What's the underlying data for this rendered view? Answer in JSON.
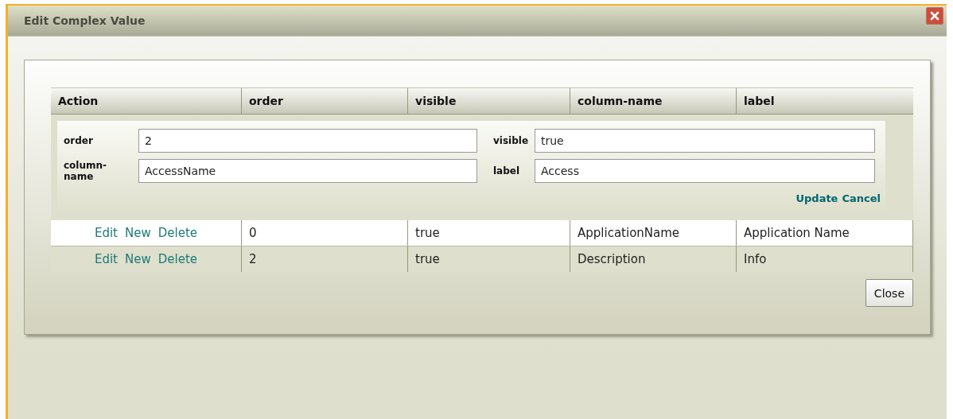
{
  "window": {
    "title": "Edit Complex Value"
  },
  "table": {
    "columns": [
      "Action",
      "order",
      "visible",
      "column-name",
      "label"
    ],
    "edit_form": {
      "fields": [
        {
          "label": "order",
          "value": "2"
        },
        {
          "label": "visible",
          "value": "true"
        },
        {
          "label": "column-name",
          "value": "AccessName"
        },
        {
          "label": "label",
          "value": "Access"
        }
      ],
      "actions": [
        "Update",
        "Cancel"
      ]
    },
    "rows": [
      {
        "cells": [
          {
            "links": [
              "Edit",
              "New",
              "Delete"
            ]
          },
          "0",
          "true",
          "ApplicationName",
          "Application Name"
        ]
      },
      {
        "cells": [
          {
            "links": [
              "Edit",
              "New",
              "Delete"
            ]
          },
          "2",
          "true",
          "Description",
          "Info"
        ]
      }
    ]
  },
  "buttons": [
    "Close"
  ]
}
